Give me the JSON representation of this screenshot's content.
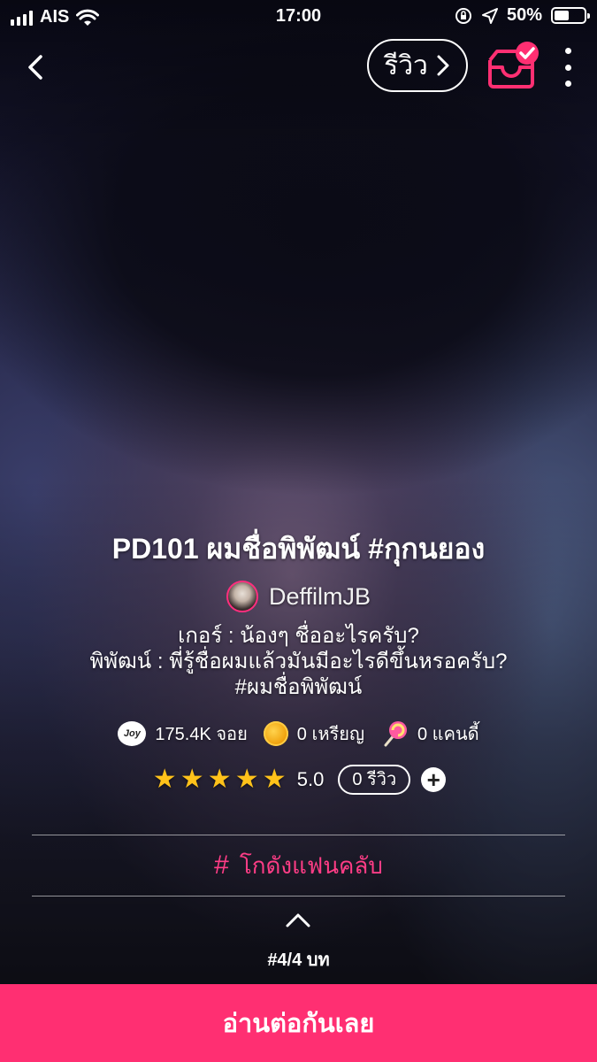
{
  "status_bar": {
    "carrier": "AIS",
    "time": "17:00",
    "battery": "50%",
    "battery_level": 0.5
  },
  "topbar": {
    "review_label": "รีวิว"
  },
  "story": {
    "title": "PD101 ผมชื่อพิพัฒน์ #กุกนยอง",
    "author": "DeffilmJB",
    "description_lines": [
      "เกอร์ : น้องๆ ชื่ออะไรครับ?",
      "พิพัฒน์ : พี่รู้ชื่อผมแล้วมันมีอะไรดีขึ้นหรอครับ?",
      "#ผมชื่อพิพัฒน์"
    ],
    "stats": {
      "joy_icon_text": "Joy",
      "joy": "175.4K จอย",
      "coins": "0 เหรียญ",
      "candy": "0 แคนดี้"
    },
    "rating": {
      "stars": 5,
      "score": "5.0",
      "reviews": "0 รีวิว"
    },
    "fan_club_label": "โกดังแฟนคลับ",
    "chapter": "#4/4 บท"
  },
  "cta": {
    "read_label": "อ่านต่อกันเลย"
  },
  "colors": {
    "accent": "#ff2f72",
    "star": "#ffc21a"
  },
  "icons": [
    "back-icon",
    "chevron-right-icon",
    "inbox-check-icon",
    "more-icon",
    "joy-icon",
    "coin-icon",
    "candy-icon",
    "star-icon",
    "plus-icon",
    "hash-icon",
    "chevron-up-icon"
  ]
}
